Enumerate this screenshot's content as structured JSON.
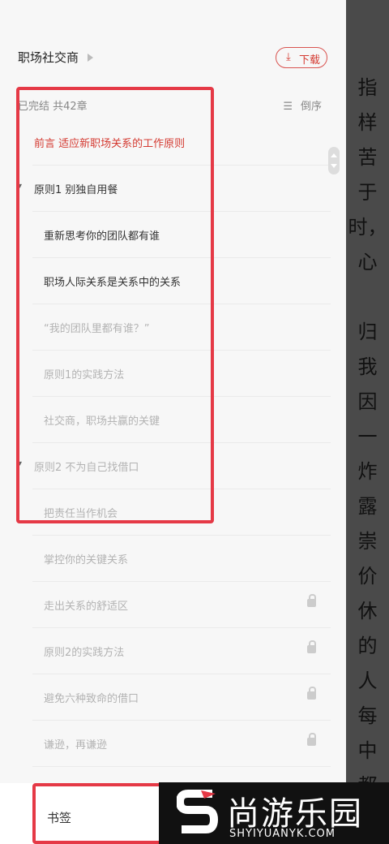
{
  "reader": {
    "chars": [
      "指",
      "样",
      "苦",
      "于",
      "时，",
      "心",
      "",
      "归",
      "我",
      "因",
      "一",
      "炸",
      "露",
      "崇",
      "价",
      "休",
      "的",
      "人",
      "每",
      "中",
      "都"
    ]
  },
  "header": {
    "book_title": "职场社交商",
    "download_label": "下载"
  },
  "toc": {
    "status": "已完结 共42章",
    "sort_label": "倒序",
    "items": [
      {
        "label": "前言 适应新职场关系的工作原则",
        "state": "active",
        "locked": false
      },
      {
        "label": "原则1 别独自用餐",
        "state": "normal",
        "locked": false,
        "volume": true
      },
      {
        "label": "重新思考你的团队都有谁",
        "state": "normal",
        "locked": false
      },
      {
        "label": "职场人际关系是关系中的关系",
        "state": "normal",
        "locked": false
      },
      {
        "label": "“我的团队里都有谁？”",
        "state": "dim",
        "locked": false
      },
      {
        "label": "原则1的实践方法",
        "state": "dim",
        "locked": false
      },
      {
        "label": "社交商，职场共赢的关键",
        "state": "dim",
        "locked": false
      },
      {
        "label": "原则2 不为自己找借口",
        "state": "dim",
        "locked": false,
        "volume": true
      },
      {
        "label": "把责任当作机会",
        "state": "dim",
        "locked": false
      },
      {
        "label": "掌控你的关键关系",
        "state": "dim",
        "locked": false
      },
      {
        "label": "走出关系的舒适区",
        "state": "dim",
        "locked": true
      },
      {
        "label": "原则2的实践方法",
        "state": "dim",
        "locked": true
      },
      {
        "label": "避免六种致命的借口",
        "state": "dim",
        "locked": true
      },
      {
        "label": "谦逊，再谦逊",
        "state": "dim",
        "locked": true
      }
    ]
  },
  "tabs": {
    "bookmarks": "书签"
  },
  "watermark": {
    "brand": "尚游乐园",
    "url": "SHYIYUANYK.COM"
  },
  "colors": {
    "accent": "#d43a31",
    "highlight_box": "#e53946"
  }
}
